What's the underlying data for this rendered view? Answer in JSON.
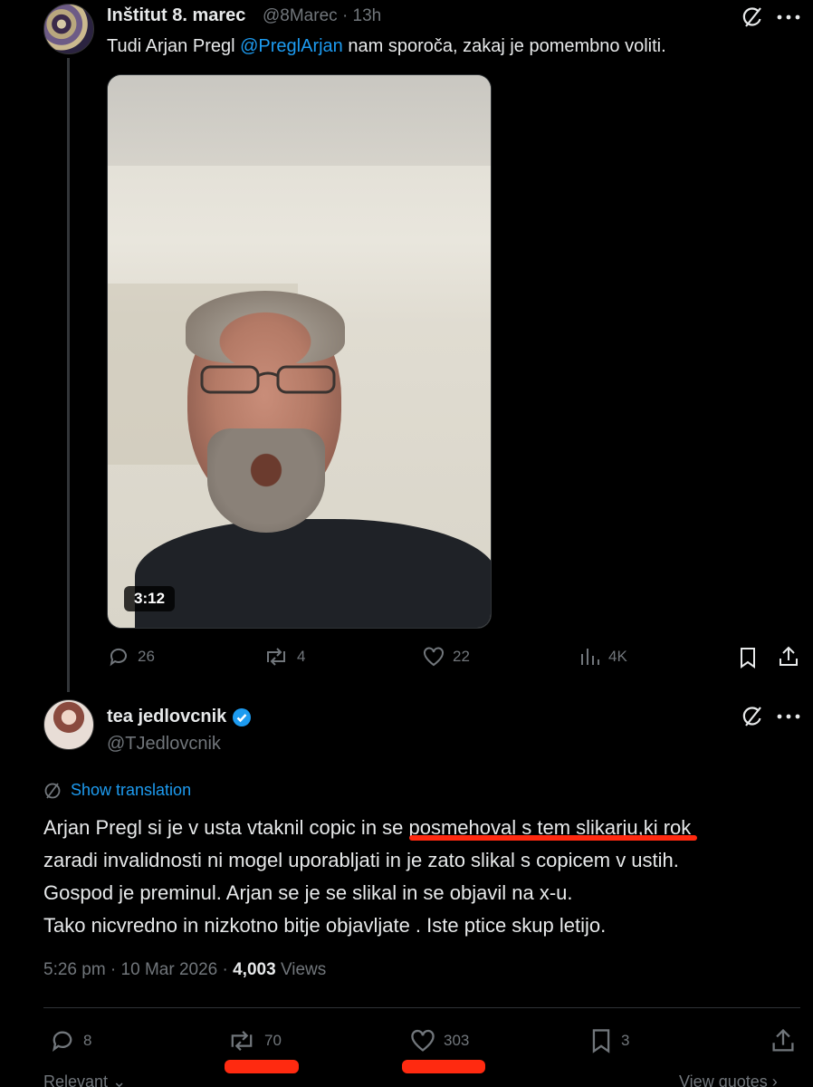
{
  "tweet1": {
    "author_name": "Inštitut 8. marec",
    "handle": "@8Marec",
    "separator": "·",
    "time": "13h",
    "text_prefix": "Tudi Arjan Pregl ",
    "mention": "@PreglArjan",
    "text_suffix": " nam sporoča, zakaj je pomembno voliti.",
    "video_duration": "3:12",
    "replies": "26",
    "reposts": "4",
    "likes": "22",
    "views": "4K"
  },
  "tweet2": {
    "author_name": "tea jedlovcnik",
    "handle": "@TJedlovcnik",
    "show_translation": "Show translation",
    "body_lines": [
      "Arjan Pregl si je v usta vtaknil copic in se posmehoval s tem slikarju,ki rok",
      "zaradi invalidnosti ni mogel uporabljati in je zato slikal s copicem v ustih.",
      "Gospod je preminul. Arjan se je se slikal in se objavil na x-u.",
      "Tako nicvredno in nizkotno bitje objavljate . Iste ptice skup letijo."
    ],
    "timestamp": "5:26 pm · 10 Mar 2026 ·",
    "views_count": "4,003",
    "views_label": "Views",
    "replies": "8",
    "reposts": "70",
    "likes": "303",
    "bookmarks": "3"
  },
  "tabs": {
    "relevant": "Relevant",
    "view_quotes": "View quotes"
  },
  "colors": {
    "background": "#000000",
    "accent": "#1d9bf0",
    "muted": "#71767b",
    "annotation_red": "#ff2a10"
  }
}
